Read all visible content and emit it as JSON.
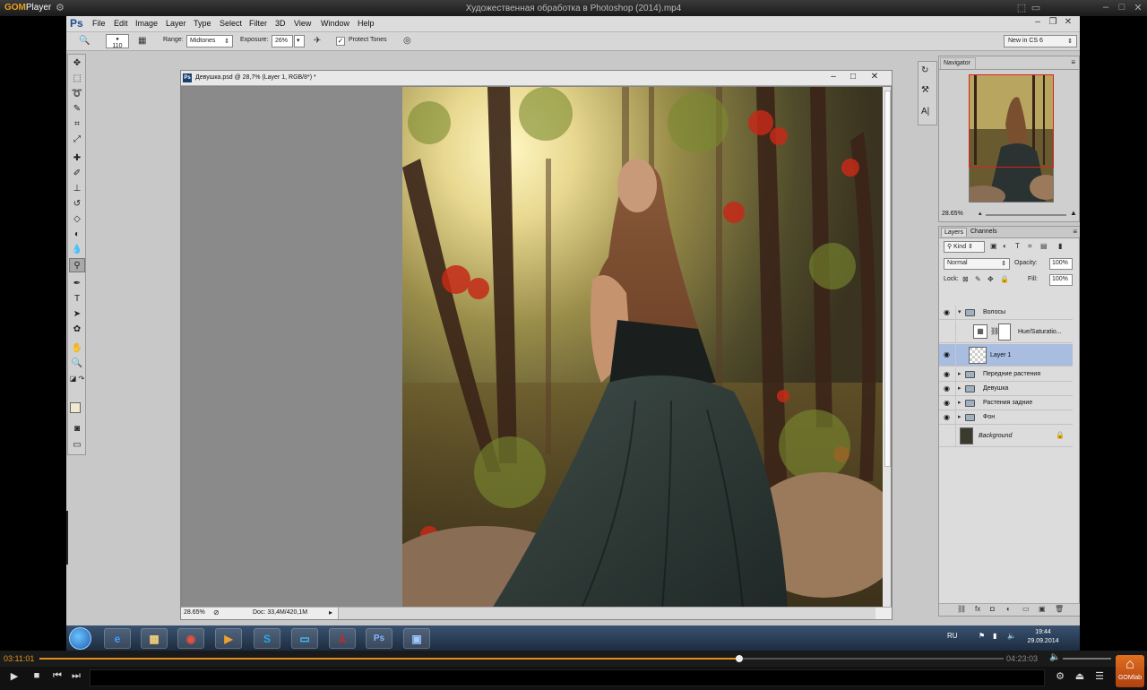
{
  "gom": {
    "logo_brand": "GOM",
    "logo_rest": "Player",
    "file_title": "Художественная обработка в Photoshop (2014).mp4",
    "time_current": "03:11:01",
    "time_total": "04:23:03",
    "progress_fraction": 0.726,
    "gomlab_label": "GOMlab"
  },
  "ps": {
    "logo": "Ps",
    "menu": [
      "File",
      "Edit",
      "Image",
      "Layer",
      "Type",
      "Select",
      "Filter",
      "3D",
      "View",
      "Window",
      "Help"
    ],
    "options": {
      "brush_size": "110",
      "range_label": "Range:",
      "range_value": "Midtones",
      "exposure_label": "Exposure:",
      "exposure_value": "26%",
      "protect_tones": "Protect Tones",
      "workspace": "New in CS 6"
    },
    "document": {
      "title": "Девушка.psd @ 28,7% (Layer 1, RGB/8*) *",
      "zoom": "28.65%",
      "doc_size": "Doc: 33,4M/420,1M"
    },
    "navigator": {
      "tab": "Navigator",
      "zoom": "28.65%"
    },
    "layers_panel": {
      "tabs": [
        "Layers",
        "Channels"
      ],
      "kind": "Kind",
      "blend_mode": "Normal",
      "opacity_label": "Opacity:",
      "opacity": "100%",
      "lock_label": "Lock:",
      "fill_label": "Fill:",
      "fill": "100%",
      "layers": [
        {
          "name": "Волосы",
          "type": "group-open",
          "visible": true
        },
        {
          "name": "Hue/Saturatio...",
          "type": "adjustment",
          "visible": false
        },
        {
          "name": "Layer 1",
          "type": "pixel",
          "visible": true,
          "selected": true
        },
        {
          "name": "Передние растения",
          "type": "group",
          "visible": true
        },
        {
          "name": "Девушка",
          "type": "group",
          "visible": true
        },
        {
          "name": "Растения задние",
          "type": "group",
          "visible": true
        },
        {
          "name": "Фон",
          "type": "group",
          "visible": true
        },
        {
          "name": "Background",
          "type": "background",
          "visible": false,
          "locked": true
        }
      ]
    }
  },
  "taskbar": {
    "apps": [
      "internet-explorer",
      "file-explorer",
      "chrome",
      "media-player",
      "skype",
      "monitor-app",
      "acrobat",
      "photoshop",
      "image-viewer"
    ],
    "photoshop_label": "Ps",
    "language": "RU",
    "clock_time": "19:44",
    "clock_date": "29.09.2014"
  },
  "colors": {
    "gom_accent": "#e09020",
    "ps_blue": "#1a4f8f",
    "selected_layer": "#a8bde0"
  }
}
